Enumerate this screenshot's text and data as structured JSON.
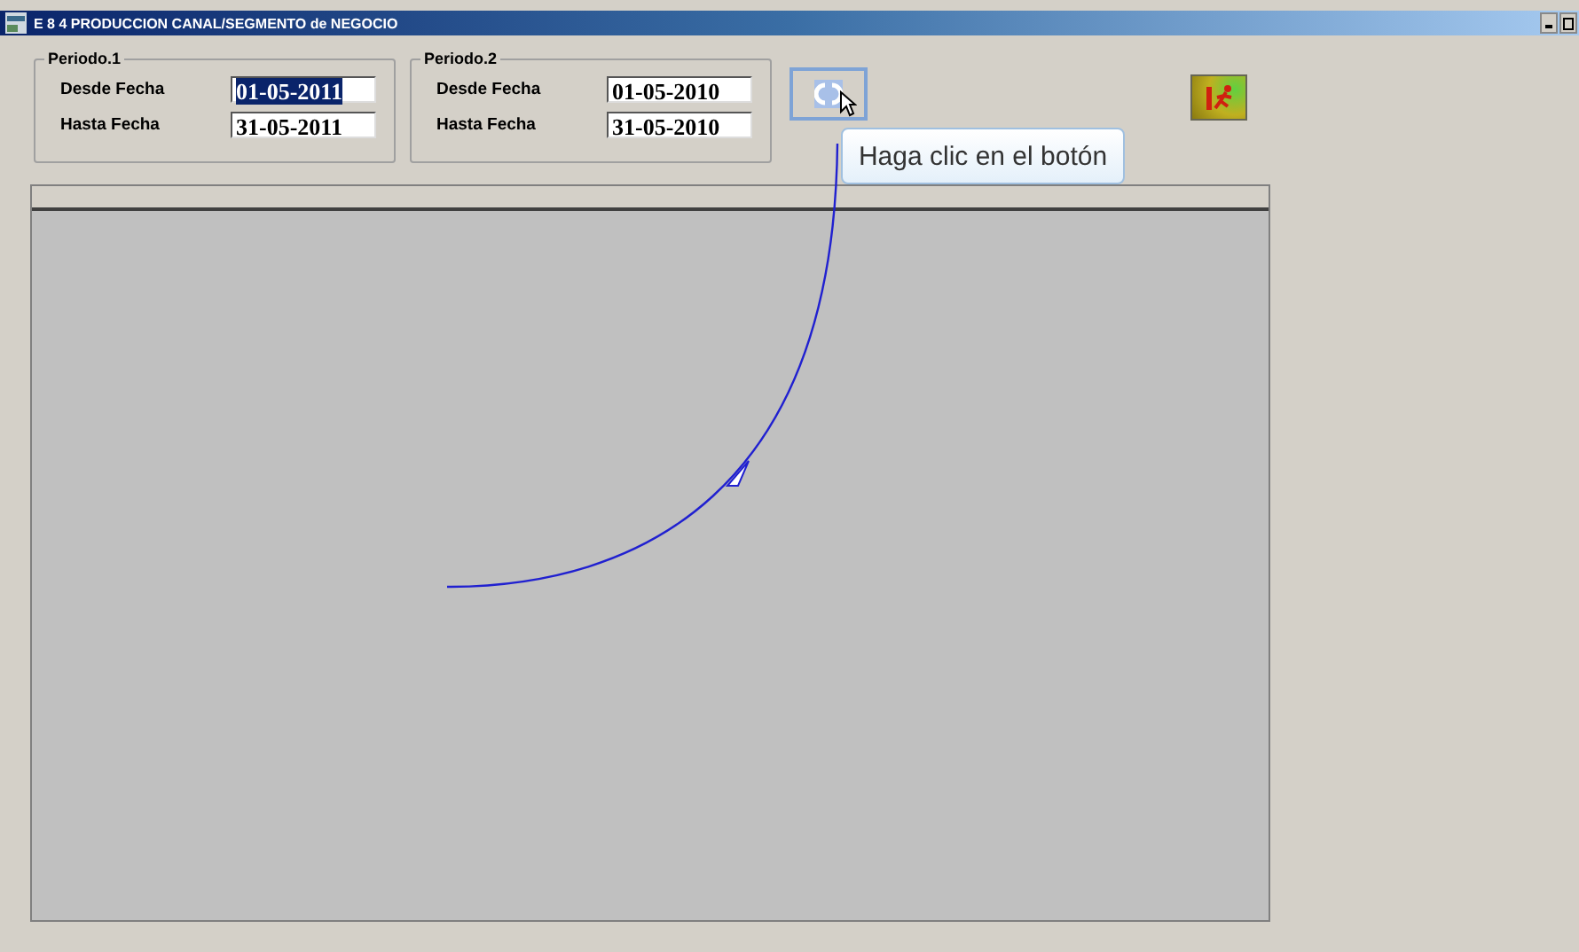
{
  "window": {
    "title": "E 8 4 PRODUCCION CANAL/SEGMENTO de NEGOCIO"
  },
  "periods": [
    {
      "title": "Periodo.1",
      "fields": [
        {
          "label": "Desde Fecha",
          "value": "01-05-2011",
          "selected": true
        },
        {
          "label": "Hasta Fecha",
          "value": "31-05-2011",
          "selected": false
        }
      ]
    },
    {
      "title": "Periodo.2",
      "fields": [
        {
          "label": "Desde Fecha",
          "value": "01-05-2010",
          "selected": false
        },
        {
          "label": "Hasta Fecha",
          "value": "31-05-2010",
          "selected": false
        }
      ]
    }
  ],
  "tooltip": "Haga clic en el botón"
}
